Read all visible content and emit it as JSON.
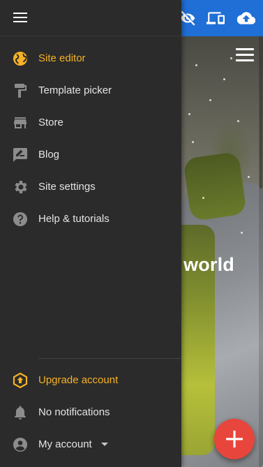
{
  "topbar": {
    "icons": [
      "eye-off-icon",
      "devices-icon",
      "cloud-upload-icon"
    ],
    "color": "#1f6fd6"
  },
  "hero": {
    "text": "world"
  },
  "drawer": {
    "items": [
      {
        "label": "Site editor",
        "icon": "globe-icon",
        "active": true
      },
      {
        "label": "Template picker",
        "icon": "paint-roller-icon"
      },
      {
        "label": "Store",
        "icon": "store-icon"
      },
      {
        "label": "Blog",
        "icon": "edit-note-icon"
      },
      {
        "label": "Site settings",
        "icon": "gear-icon"
      },
      {
        "label": "Help & tutorials",
        "icon": "help-icon"
      }
    ],
    "footer": [
      {
        "label": "Upgrade account",
        "icon": "upgrade-icon"
      },
      {
        "label": "No notifications",
        "icon": "bell-icon"
      },
      {
        "label": "My account",
        "icon": "account-circle-icon"
      }
    ]
  },
  "colors": {
    "accent": "#f5b227",
    "drawer_bg": "#2b2b2b",
    "fab": "#e8453c"
  },
  "fab": {
    "icon": "plus-icon",
    "symbol": "+"
  }
}
